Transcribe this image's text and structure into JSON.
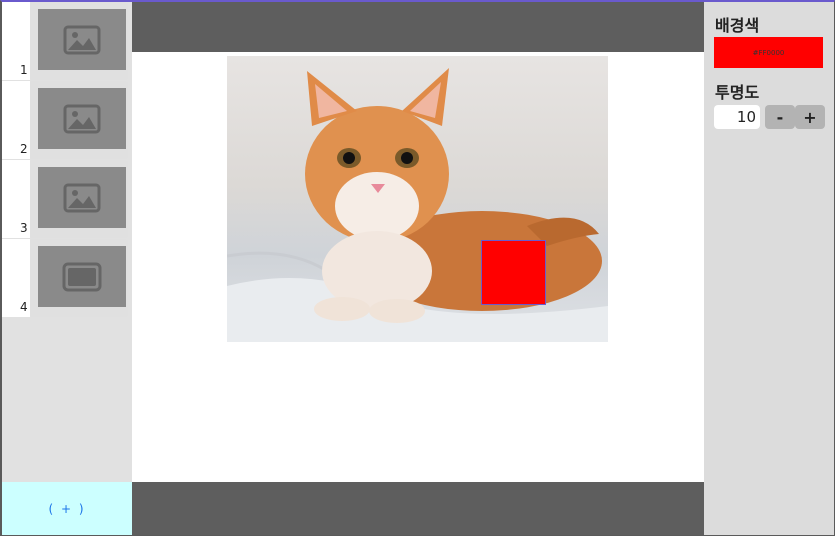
{
  "slides": [
    {
      "number": "1",
      "thumb_icon": "image-icon"
    },
    {
      "number": "2",
      "thumb_icon": "image-icon"
    },
    {
      "number": "3",
      "thumb_icon": "image-icon"
    },
    {
      "number": "4",
      "thumb_icon": "rectangle-icon"
    }
  ],
  "add_slide_label": "( + )",
  "canvas": {
    "image": "orange-kitten-photo",
    "overlay_color": "#FF0000"
  },
  "properties": {
    "bg_color_label": "배경색",
    "bg_color_value": "#FF0000",
    "opacity_label": "투명도",
    "opacity_value": "10",
    "minus_label": "-",
    "plus_label": "+"
  }
}
